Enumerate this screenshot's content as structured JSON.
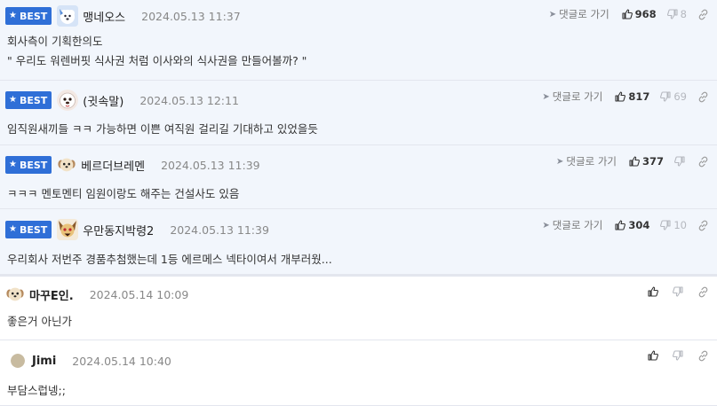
{
  "best_label": "BEST",
  "reply_label": "댓글로 가기",
  "comments": [
    {
      "best": true,
      "nickname": "맹네오스",
      "date": "2024.05.13 11:37",
      "likes": "968",
      "dislikes": "8",
      "lines": [
        "회사측이 기획한의도",
        "\" 우리도 워렌버핏 식사권 처럼 이사와의 식사권을 만들어볼까? \""
      ],
      "avatar": "blue-fluffy-dog"
    },
    {
      "best": true,
      "nickname": "(귓속말)",
      "date": "2024.05.13 12:11",
      "likes": "817",
      "dislikes": "69",
      "lines": [
        "임직원새끼들 ㅋㅋ 가능하면 이쁜 여직원 걸리길 기대하고 있었을듯"
      ],
      "avatar": "maltese-dog"
    },
    {
      "best": true,
      "nickname": "베르더브레멘",
      "date": "2024.05.13 11:39",
      "likes": "377",
      "dislikes": "0",
      "lines": [
        "ㅋㅋㅋ 멘토멘티 임원이랑도 해주는 건설사도 있음"
      ],
      "avatar": "puppy-face"
    },
    {
      "best": true,
      "nickname": "우만동지박령2",
      "date": "2024.05.13 11:39",
      "likes": "304",
      "dislikes": "10",
      "lines": [
        "우리회사 저번주 경품추첨했는데 1등 에르메스 넥타이여서 개부러웠..."
      ],
      "avatar": "spooky-dog"
    },
    {
      "best": false,
      "nickname": "마꾸E인.",
      "date": "2024.05.14 10:09",
      "lines": [
        "좋은거 아닌가"
      ],
      "avatar": "puppy-face"
    },
    {
      "best": false,
      "nickname": "Jimi",
      "date": "2024.05.14 10:40",
      "lines": [
        "부담스럽넹;;"
      ],
      "avatar": "grey-circle"
    }
  ]
}
